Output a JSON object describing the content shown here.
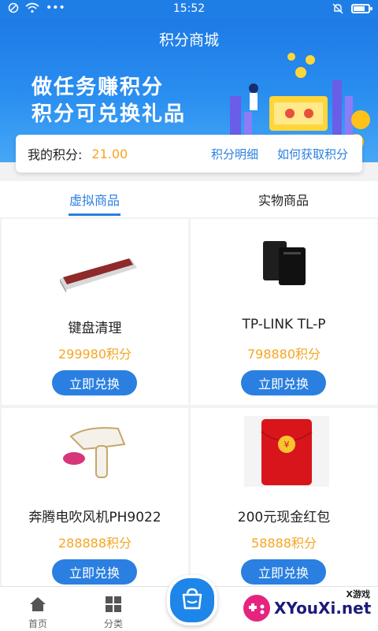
{
  "status_bar": {
    "time": "15:52"
  },
  "header": {
    "title": "积分商城",
    "slogan_line1": "做任务赚积分",
    "slogan_line2": "积分可兑换礼品"
  },
  "points": {
    "label": "我的积分:",
    "value": "21.00",
    "detail_link": "积分明细",
    "how_link": "如何获取积分"
  },
  "tabs": [
    {
      "label": "虚拟商品",
      "active": true
    },
    {
      "label": "实物商品",
      "active": false
    }
  ],
  "products": [
    {
      "name": "键盘清理",
      "price": "299980积分",
      "button": "立即兑换"
    },
    {
      "name": "TP-LINK TL-P",
      "price": "798880积分",
      "button": "立即兑换"
    },
    {
      "name": "奔腾电吹风机PH9022",
      "price": "288888积分",
      "button": "立即兑换"
    },
    {
      "name": "200元现金红包",
      "price": "58888积分",
      "button": "立即兑换"
    }
  ],
  "bottom_nav": [
    {
      "label": "首页",
      "icon": "home-icon"
    },
    {
      "label": "分类",
      "icon": "category-grid-icon"
    }
  ],
  "watermark": {
    "text": "XYouXi.net",
    "small_text": "X游戏"
  },
  "colors": {
    "primary": "#2a7fe0",
    "price": "#f5a623",
    "red_packet": "#d9151c"
  }
}
